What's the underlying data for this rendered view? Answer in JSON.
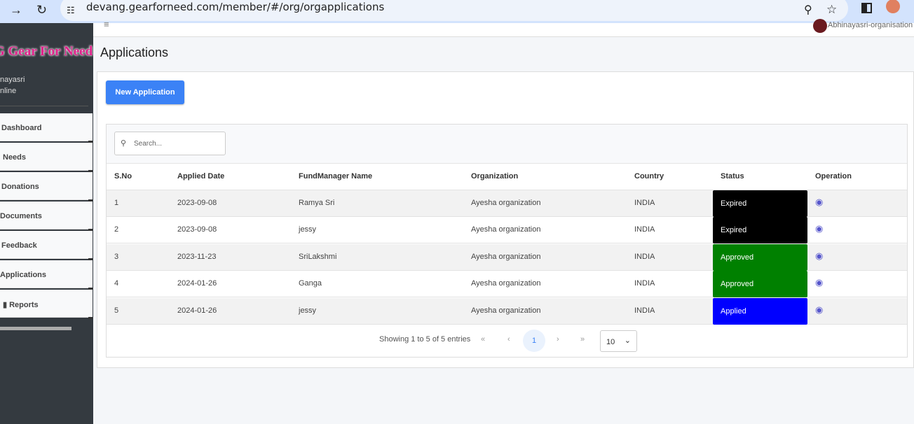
{
  "browser": {
    "url": "devang.gearforneed.com/member/#/org/orgapplications"
  },
  "sidebar": {
    "logo": "G Gear For Need",
    "user_name": "nayasri",
    "user_status": "nline",
    "items": [
      {
        "label": "Dashboard"
      },
      {
        "label": "Needs"
      },
      {
        "label": "Donations"
      },
      {
        "label": "Documents"
      },
      {
        "label": "Feedback"
      },
      {
        "label": "Applications"
      },
      {
        "label": "Reports"
      }
    ]
  },
  "header": {
    "menu_icon": "≡",
    "user": "Abhinayasri-organisation"
  },
  "page": {
    "title": "Applications",
    "new_button": "New Application"
  },
  "table": {
    "search_placeholder": "Search...",
    "columns": [
      "S.No",
      "Applied Date",
      "FundManager Name",
      "Organization",
      "Country",
      "Status",
      "Operation"
    ],
    "rows": [
      {
        "sno": "1",
        "date": "2023-09-08",
        "manager": "Ramya Sri",
        "org": "Ayesha organization",
        "country": "INDIA",
        "status": "Expired",
        "color": "#000000"
      },
      {
        "sno": "2",
        "date": "2023-09-08",
        "manager": "jessy",
        "org": "Ayesha organization",
        "country": "INDIA",
        "status": "Expired",
        "color": "#000000"
      },
      {
        "sno": "3",
        "date": "2023-11-23",
        "manager": "SriLakshmi",
        "org": "Ayesha organization",
        "country": "INDIA",
        "status": "Approved",
        "color": "#008000"
      },
      {
        "sno": "4",
        "date": "2024-01-26",
        "manager": "Ganga",
        "org": "Ayesha organization",
        "country": "INDIA",
        "status": "Approved",
        "color": "#008000"
      },
      {
        "sno": "5",
        "date": "2024-01-26",
        "manager": "jessy",
        "org": "Ayesha organization",
        "country": "INDIA",
        "status": "Applied",
        "color": "#0000ff"
      }
    ]
  },
  "pagination": {
    "info": "Showing 1 to 5 of 5 entries",
    "first": "«",
    "prev": "‹",
    "page": "1",
    "next": "›",
    "last": "»",
    "page_size": "10"
  }
}
